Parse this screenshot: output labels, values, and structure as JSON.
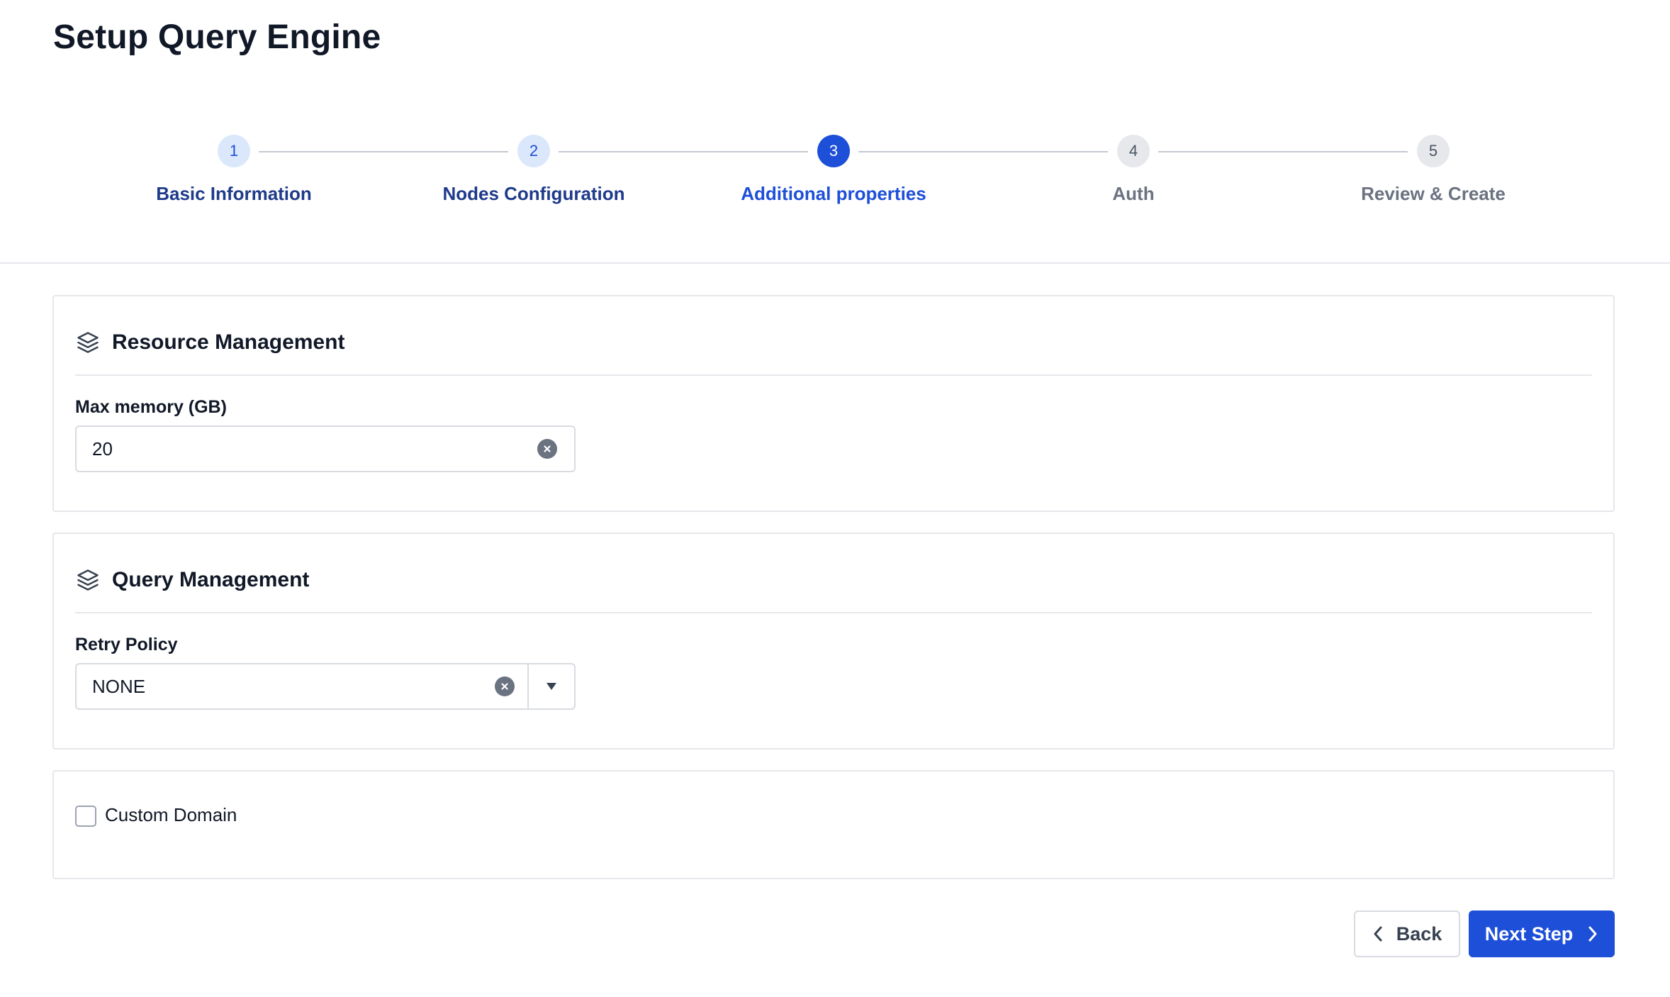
{
  "page": {
    "title": "Setup Query Engine"
  },
  "stepper": {
    "steps": [
      {
        "number": "1",
        "label": "Basic Information",
        "state": "done"
      },
      {
        "number": "2",
        "label": "Nodes Configuration",
        "state": "done"
      },
      {
        "number": "3",
        "label": "Additional properties",
        "state": "current"
      },
      {
        "number": "4",
        "label": "Auth",
        "state": "upcoming"
      },
      {
        "number": "5",
        "label": "Review & Create",
        "state": "upcoming"
      }
    ]
  },
  "resource_management": {
    "title": "Resource Management",
    "icon": "layers-icon",
    "max_memory": {
      "label": "Max memory (GB)",
      "value": "20"
    }
  },
  "query_management": {
    "title": "Query Management",
    "icon": "layers-icon",
    "retry_policy": {
      "label": "Retry Policy",
      "value": "NONE"
    }
  },
  "custom_domain": {
    "label": "Custom Domain",
    "checked": false
  },
  "footer": {
    "back_label": "Back",
    "next_label": "Next Step"
  },
  "colors": {
    "primary": "#1d4fd8",
    "step_done_bg": "#dbe8fc",
    "step_upcoming_bg": "#e6e8ec",
    "border": "#e5e7eb"
  }
}
